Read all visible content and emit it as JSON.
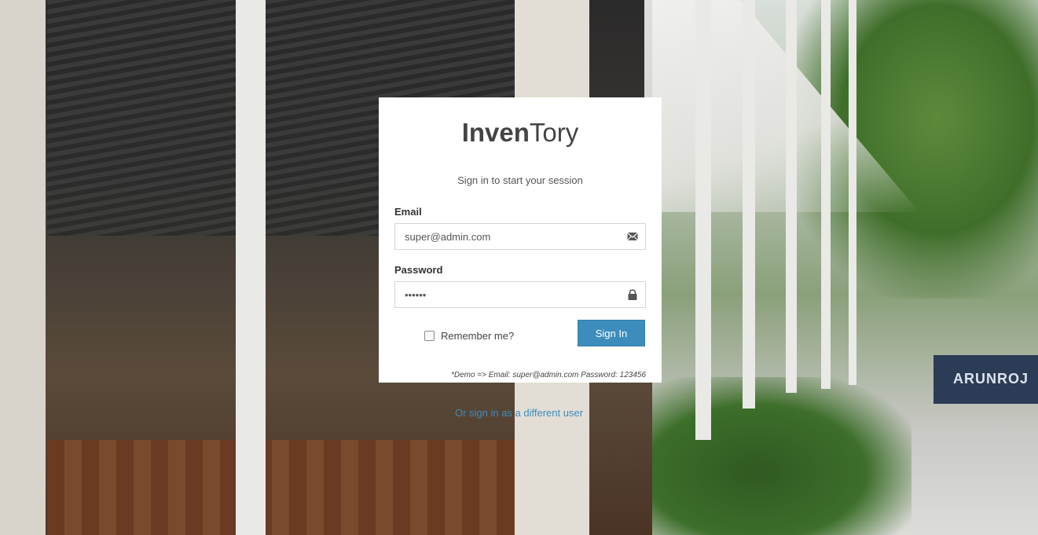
{
  "logo": {
    "bold": "Inven",
    "light": "Tory"
  },
  "subtitle": "Sign in to start your session",
  "form": {
    "email_label": "Email",
    "email_value": "super@admin.com",
    "email_icon": "envelope-icon",
    "password_label": "Password",
    "password_value": "••••••",
    "password_icon": "lock-icon",
    "remember_label": "Remember me?",
    "remember_checked": false,
    "signin_label": "Sign In"
  },
  "demo_note": "*Demo => Email: super@admin.com Password: 123456",
  "other_link": "Or sign in as a different user",
  "background_sign": "ARUNROJ",
  "colors": {
    "primary": "#3c8dbc",
    "box_bg": "#ffffff"
  }
}
